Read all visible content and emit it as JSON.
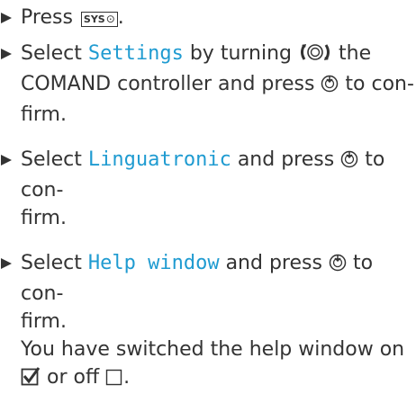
{
  "steps": [
    {
      "prefix": "Press",
      "key_label": "SYS",
      "suffix": "."
    },
    {
      "select": "Select",
      "menu_item": "Settings",
      "mid": "by turning",
      "mid2": "the COMAND controller and press",
      "end": "to con-firm."
    },
    {
      "select": "Select",
      "menu_item": "Linguatronic",
      "mid": "and press",
      "end": "to con-firm."
    },
    {
      "select": "Select",
      "menu_item": "Help window",
      "mid": "and press",
      "end": "to con-firm."
    }
  ],
  "result": {
    "text": "You have switched the help window on",
    "or_off": "or off",
    "period": "."
  },
  "icons": {
    "step_marker": "triangle-right-icon",
    "rotate_controller": "controller-rotate-icon",
    "press_controller": "controller-press-icon",
    "checked": "checkbox-checked-icon",
    "unchecked": "checkbox-unchecked-icon"
  },
  "colors": {
    "text": "#333333",
    "menu_item": "#1f9bd1"
  }
}
